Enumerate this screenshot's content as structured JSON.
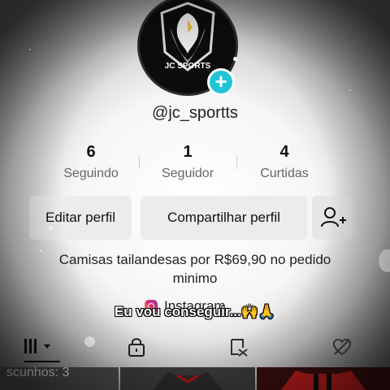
{
  "profile": {
    "logo_text": "JC SPORTS",
    "username": "@jc_sportts",
    "stats": [
      {
        "value": "6",
        "label": "Seguindo"
      },
      {
        "value": "1",
        "label": "Seguidor"
      },
      {
        "value": "4",
        "label": "Curtidas"
      }
    ],
    "bio_line1": "Camisas tailandesas por R$69,90 no pedido",
    "bio_line2": "minimo",
    "link_label": "Instagram"
  },
  "actions": {
    "edit_label": "Editar perfil",
    "share_label": "Compartilhar perfil"
  },
  "overlay": {
    "caption": "Eu vou conseguir...🙌🙏"
  },
  "grid": {
    "drafts_label": "scunhos: 3"
  },
  "colors": {
    "accent": "#20c5d6",
    "button_bg": "#ececec"
  },
  "icons": [
    "plus-icon",
    "add-friend-icon",
    "instagram-icon",
    "grid-icon",
    "lock-icon",
    "repost-icon",
    "liked-icon"
  ]
}
